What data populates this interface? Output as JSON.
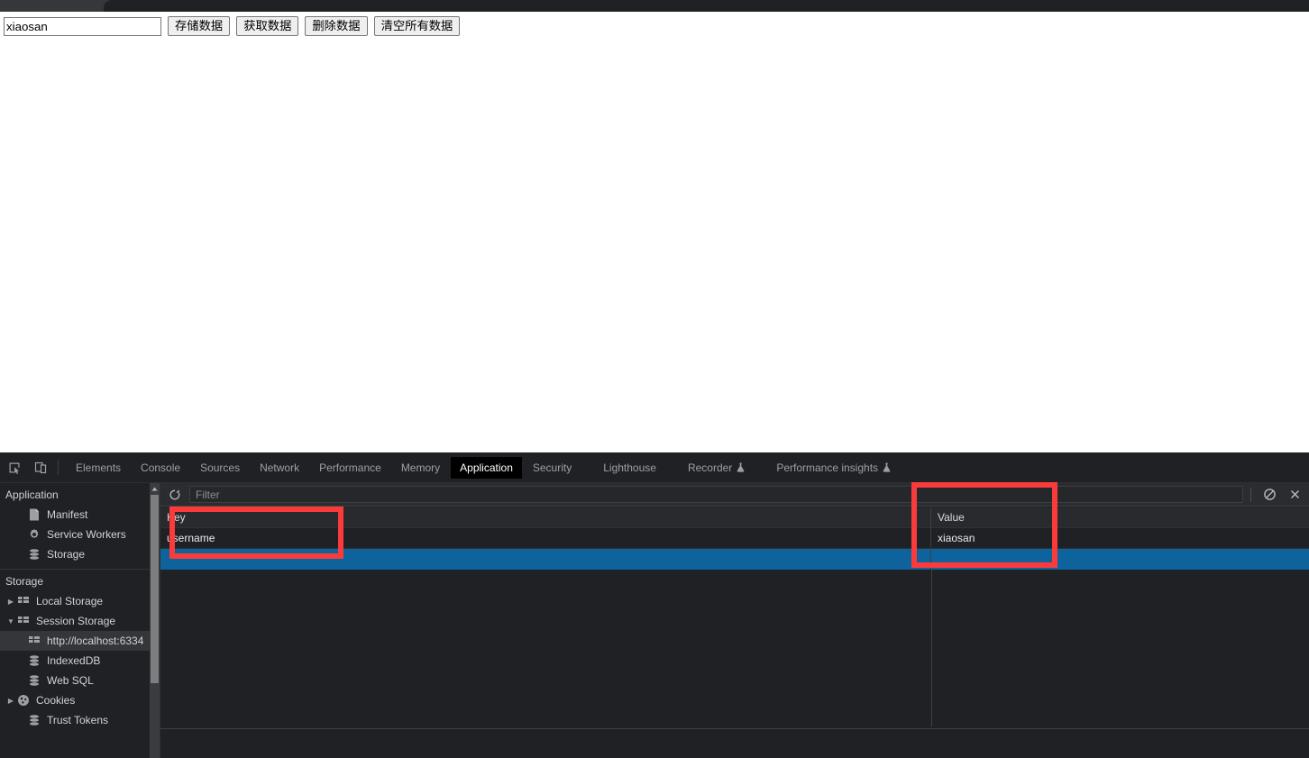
{
  "page": {
    "input": {
      "value": "xiaosan",
      "placeholder": ""
    },
    "buttons": [
      {
        "name": "store-data-button",
        "label": "存储数据"
      },
      {
        "name": "get-data-button",
        "label": "获取数据"
      },
      {
        "name": "delete-data-button",
        "label": "删除数据"
      },
      {
        "name": "clear-all-button",
        "label": "清空所有数据"
      }
    ]
  },
  "devtools": {
    "tabs": [
      {
        "label": "Elements",
        "selected": false,
        "beaker": false
      },
      {
        "label": "Console",
        "selected": false,
        "beaker": false
      },
      {
        "label": "Sources",
        "selected": false,
        "beaker": false
      },
      {
        "label": "Network",
        "selected": false,
        "beaker": false
      },
      {
        "label": "Performance",
        "selected": false,
        "beaker": false
      },
      {
        "label": "Memory",
        "selected": false,
        "beaker": false
      },
      {
        "label": "Application",
        "selected": true,
        "beaker": false
      },
      {
        "label": "Security",
        "selected": false,
        "beaker": false
      },
      {
        "label": "Lighthouse",
        "selected": false,
        "beaker": false
      },
      {
        "label": "Recorder",
        "selected": false,
        "beaker": true
      },
      {
        "label": "Performance insights",
        "selected": false,
        "beaker": true
      }
    ],
    "sidebar": {
      "application_title": "Application",
      "application_items": [
        {
          "name": "sidebar-item-manifest",
          "label": "Manifest",
          "icon": "document-icon",
          "arrow": "none",
          "selected": false
        },
        {
          "name": "sidebar-item-service-workers",
          "label": "Service Workers",
          "icon": "gear-icon",
          "arrow": "none",
          "selected": false
        },
        {
          "name": "sidebar-item-storage",
          "label": "Storage",
          "icon": "database-icon",
          "arrow": "none",
          "selected": false
        }
      ],
      "storage_title": "Storage",
      "storage_items": [
        {
          "name": "sidebar-item-local-storage",
          "label": "Local Storage",
          "icon": "table-icon",
          "arrow": "collapsed",
          "selected": false
        },
        {
          "name": "sidebar-item-session-storage",
          "label": "Session Storage",
          "icon": "table-icon",
          "arrow": "expanded",
          "selected": false
        },
        {
          "name": "sidebar-item-session-origin",
          "label": "http://localhost:6334",
          "icon": "table-icon",
          "arrow": "none",
          "selected": true,
          "child": true
        },
        {
          "name": "sidebar-item-indexeddb",
          "label": "IndexedDB",
          "icon": "database-icon",
          "arrow": "none",
          "selected": false
        },
        {
          "name": "sidebar-item-web-sql",
          "label": "Web SQL",
          "icon": "database-icon",
          "arrow": "none",
          "selected": false
        },
        {
          "name": "sidebar-item-cookies",
          "label": "Cookies",
          "icon": "cookie-icon",
          "arrow": "collapsed",
          "selected": false
        },
        {
          "name": "sidebar-item-trust-tokens",
          "label": "Trust Tokens",
          "icon": "database-icon",
          "arrow": "none",
          "selected": false
        }
      ]
    },
    "toolbar": {
      "refresh_icon": "refresh-icon",
      "filter_placeholder": "Filter",
      "filter_value": "",
      "clear_all_icon": "clear-all-icon",
      "delete_selected_icon": "delete-selected-icon"
    },
    "grid": {
      "columns": [
        "Key",
        "Value"
      ],
      "rows": [
        {
          "key": "username",
          "value": "xiaosan",
          "selected": false
        },
        {
          "key": "",
          "value": "",
          "selected": true
        }
      ]
    }
  },
  "annotations": {
    "key_box_color": "#fb3b3b",
    "value_box_color": "#fb3b3b"
  }
}
